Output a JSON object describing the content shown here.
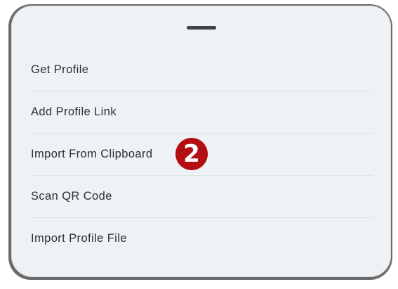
{
  "menu": {
    "items": [
      {
        "label": "Get Profile"
      },
      {
        "label": "Add Profile Link"
      },
      {
        "label": "Import From Clipboard"
      },
      {
        "label": "Scan QR Code"
      },
      {
        "label": "Import Profile File"
      }
    ]
  },
  "annotation": {
    "step_number": "2",
    "color": "#b30e12"
  }
}
